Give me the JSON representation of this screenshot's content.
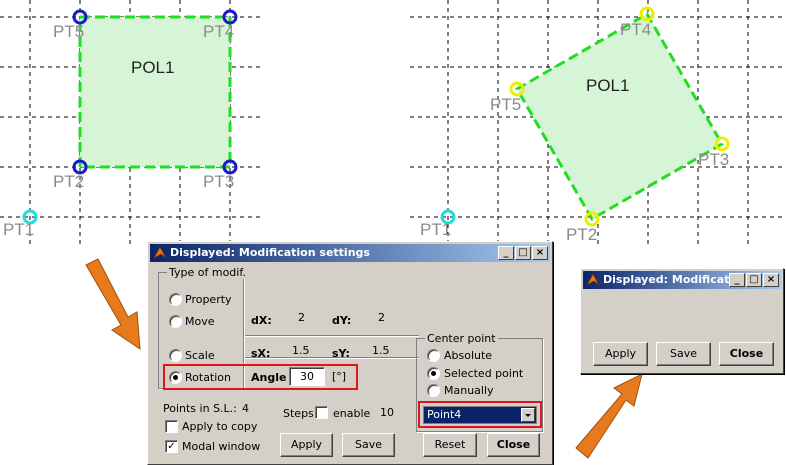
{
  "left_view": {
    "polygon_label": "POL1",
    "points": [
      "PT5",
      "PT4",
      "PT2",
      "PT3",
      "PT1"
    ]
  },
  "right_view": {
    "polygon_label": "POL1",
    "points": [
      "PT4",
      "PT5",
      "PT3",
      "PT2",
      "PT1"
    ]
  },
  "colors": {
    "polygon_fill": "#d6f5d6",
    "polygon_edge": "#22dd22",
    "vertex_blue": "#1a1acc",
    "vertex_yellow": "#eeee00",
    "vertex_cyan": "#22dddd",
    "arrow": "#e87a1e",
    "highlight": "#e0141e",
    "titlebar": "#0a246a"
  },
  "main_dialog": {
    "title": "Displayed: Modification settings",
    "titlebar_buttons": [
      "_",
      "□",
      "×"
    ],
    "type_group": {
      "title": "Type of modif.",
      "options": [
        "Property",
        "Move",
        "Scale",
        "Rotation"
      ],
      "selected": "Rotation"
    },
    "dx_label": "dX:",
    "dx_value": "2",
    "dy_label": "dY:",
    "dy_value": "2",
    "sx_label": "sX:",
    "sx_value": "1.5",
    "sy_label": "sY:",
    "sy_value": "1.5",
    "angle_label": "Angle",
    "angle_value": "30",
    "angle_unit": "[°]",
    "center_group": {
      "title": "Center point",
      "options": [
        "Absolute",
        "Selected point",
        "Manually"
      ],
      "selected": "Selected point",
      "dropdown_value": "Point4"
    },
    "points_label": "Points in S.L.:",
    "points_value": "4",
    "steps_label": "Steps:",
    "steps_enable": "enable",
    "steps_value": "10",
    "apply_to_copy": "Apply to copy",
    "modal_window": "Modal window",
    "buttons": {
      "apply": "Apply",
      "save": "Save",
      "reset": "Reset",
      "close": "Close"
    }
  },
  "small_dialog": {
    "title": "Displayed: Modificatio",
    "titlebar_buttons": [
      "_",
      "□",
      "×"
    ],
    "buttons": {
      "apply": "Apply",
      "save": "Save",
      "close": "Close"
    }
  }
}
